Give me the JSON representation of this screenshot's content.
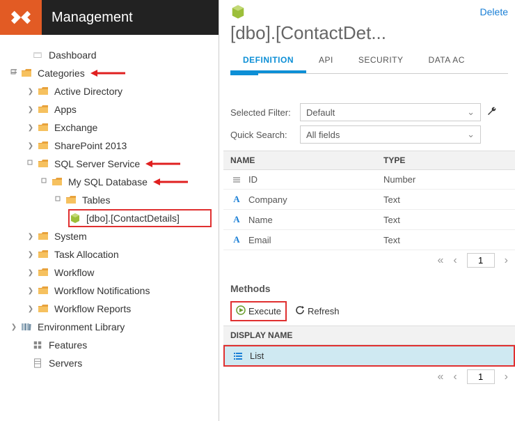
{
  "app": {
    "name": "Management"
  },
  "header_actions": {
    "delete": "Delete"
  },
  "object": {
    "title": "[dbo].[ContactDet..."
  },
  "tabs": {
    "definition": "DEFINITION",
    "api": "API",
    "security": "SECURITY",
    "data_access": "DATA AC"
  },
  "filters": {
    "selected_filter_label": "Selected Filter:",
    "selected_filter_value": "Default",
    "quick_search_label": "Quick Search:",
    "quick_search_value": "All fields"
  },
  "table": {
    "headers": {
      "name": "NAME",
      "type": "TYPE"
    },
    "rows": [
      {
        "name": "ID",
        "type": "Number",
        "icon": "list"
      },
      {
        "name": "Company",
        "type": "Text",
        "icon": "A"
      },
      {
        "name": "Name",
        "type": "Text",
        "icon": "A"
      },
      {
        "name": "Email",
        "type": "Text",
        "icon": "A"
      }
    ],
    "pager": {
      "page": "1"
    }
  },
  "methods": {
    "title": "Methods",
    "execute": "Execute",
    "refresh": "Refresh",
    "header": "DISPLAY NAME",
    "row": "List",
    "pager": {
      "page": "1"
    }
  },
  "tree": {
    "dashboard": "Dashboard",
    "categories": "Categories",
    "active_directory": "Active Directory",
    "apps": "Apps",
    "exchange": "Exchange",
    "sharepoint": "SharePoint 2013",
    "sql_server_service": "SQL Server Service",
    "my_sql_database": "My SQL Database",
    "tables": "Tables",
    "contactdetails": "[dbo].[ContactDetails]",
    "system": "System",
    "task_allocation": "Task Allocation",
    "workflow": "Workflow",
    "wf_notifications": "Workflow Notifications",
    "wf_reports": "Workflow Reports",
    "env_library": "Environment Library",
    "features": "Features",
    "servers": "Servers"
  }
}
